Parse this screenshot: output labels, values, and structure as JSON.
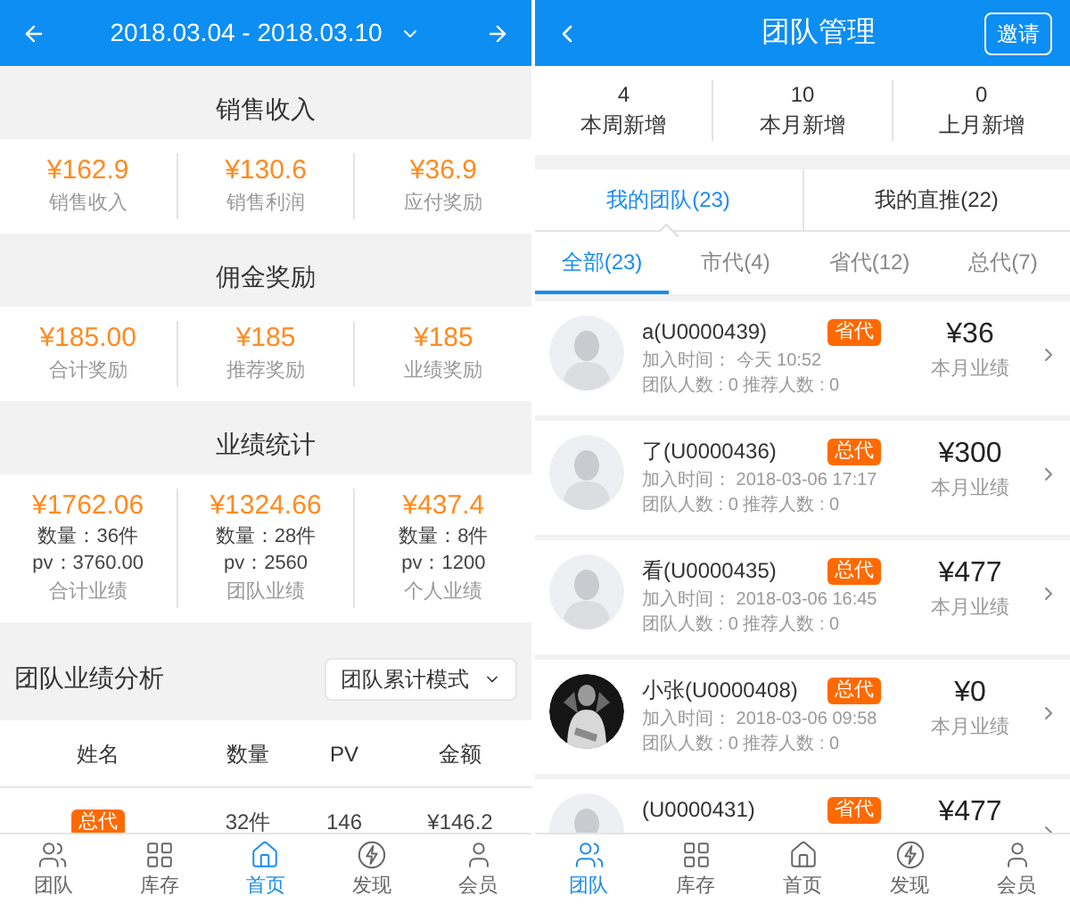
{
  "left": {
    "header": {
      "date_range": "2018.03.04 - 2018.03.10"
    },
    "sections": [
      {
        "title": "销售收入",
        "items": [
          {
            "value": "¥162.9",
            "label": "销售收入"
          },
          {
            "value": "¥130.6",
            "label": "销售利润"
          },
          {
            "value": "¥36.9",
            "label": "应付奖励"
          }
        ]
      },
      {
        "title": "佣金奖励",
        "items": [
          {
            "value": "¥185.00",
            "label": "合计奖励"
          },
          {
            "value": "¥185",
            "label": "推荐奖励"
          },
          {
            "value": "¥185",
            "label": "业绩奖励"
          }
        ]
      },
      {
        "title": "业绩统计",
        "items": [
          {
            "value": "¥1762.06",
            "lines": [
              "数量：36件",
              "pv：3760.00"
            ],
            "label": "合计业绩"
          },
          {
            "value": "¥1324.66",
            "lines": [
              "数量：28件",
              "pv：2560"
            ],
            "label": "团队业绩"
          },
          {
            "value": "¥437.4",
            "lines": [
              "数量：8件",
              "pv：1200"
            ],
            "label": "个人业绩"
          }
        ]
      }
    ],
    "analysis": {
      "title": "团队业绩分析",
      "mode": "团队累计模式"
    },
    "table": {
      "columns": [
        "姓名",
        "数量",
        "PV",
        "金额"
      ],
      "rows": [
        {
          "badge": "总代",
          "quantity": "32件",
          "pv": "146",
          "amount": "¥146.2"
        }
      ]
    },
    "nav": [
      {
        "label": "团队",
        "selected": false
      },
      {
        "label": "库存",
        "selected": false
      },
      {
        "label": "首页",
        "selected": true
      },
      {
        "label": "发现",
        "selected": false
      },
      {
        "label": "会员",
        "selected": false
      }
    ]
  },
  "right": {
    "header": {
      "title": "团队管理",
      "action": "邀请"
    },
    "stats": [
      {
        "value": "4",
        "label": "本周新增"
      },
      {
        "value": "10",
        "label": "本月新增"
      },
      {
        "value": "0",
        "label": "上月新增"
      }
    ],
    "tabs": [
      {
        "label": "我的团队(23)",
        "selected": true
      },
      {
        "label": "我的直推(22)",
        "selected": false
      }
    ],
    "filters": [
      {
        "label": "全部(23)",
        "selected": true
      },
      {
        "label": "市代(4)",
        "selected": false
      },
      {
        "label": "省代(12)",
        "selected": false
      },
      {
        "label": "总代(7)",
        "selected": false
      }
    ],
    "members": [
      {
        "name": "a(U0000439)",
        "badge": "省代",
        "join": "加入时间： 今天 10:52",
        "counts": "团队人数 : 0 推荐人数 : 0",
        "amount": "¥36",
        "amount_label": "本月业绩",
        "kind": "default"
      },
      {
        "name": "了(U0000436)",
        "badge": "总代",
        "join": "加入时间： 2018-03-06 17:17",
        "counts": "团队人数 : 0 推荐人数 : 0",
        "amount": "¥300",
        "amount_label": "本月业绩",
        "kind": "default"
      },
      {
        "name": "看(U0000435)",
        "badge": "总代",
        "join": "加入时间： 2018-03-06 16:45",
        "counts": "团队人数 : 0 推荐人数 : 0",
        "amount": "¥477",
        "amount_label": "本月业绩",
        "kind": "default"
      },
      {
        "name": "小张(U0000408)",
        "badge": "总代",
        "join": "加入时间： 2018-03-06 09:58",
        "counts": "团队人数 : 0 推荐人数 : 0",
        "amount": "¥0",
        "amount_label": "本月业绩",
        "kind": "picture"
      },
      {
        "name": "(U0000431)",
        "badge": "省代",
        "amount": "¥477",
        "kind": "default"
      }
    ],
    "nav": [
      {
        "label": "团队",
        "selected": true
      },
      {
        "label": "库存",
        "selected": false
      },
      {
        "label": "首页",
        "selected": false
      },
      {
        "label": "发现",
        "selected": false
      },
      {
        "label": "会员",
        "selected": false
      }
    ]
  }
}
